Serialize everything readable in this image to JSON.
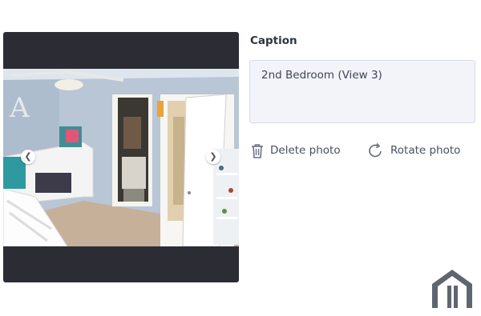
{
  "photo": {
    "alt": "2nd Bedroom (View 3)",
    "prev_icon": "chevron-left-icon",
    "next_icon": "chevron-right-icon"
  },
  "caption": {
    "label": "Caption",
    "value": "2nd Bedroom (View 3)"
  },
  "actions": {
    "delete": {
      "label": "Delete photo",
      "icon": "trash-icon"
    },
    "rotate": {
      "label": "Rotate photo",
      "icon": "rotate-icon"
    }
  },
  "brand": {
    "icon": "house-logo-icon",
    "color": "#5f6670"
  },
  "colors": {
    "frame": "#2b2c34",
    "caption_bg": "#f3f4f9",
    "text": "#3a4150"
  }
}
